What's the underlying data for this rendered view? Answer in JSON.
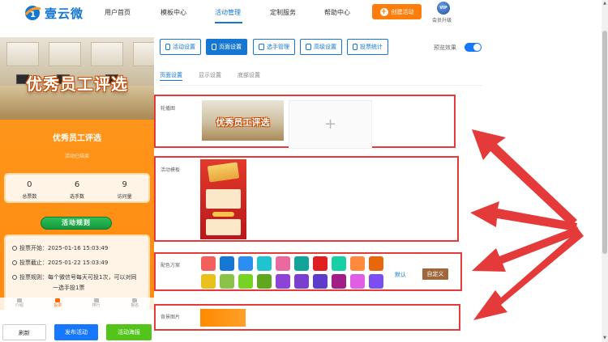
{
  "app": {
    "logo_text": "壹云微"
  },
  "nav": {
    "items": [
      "用户首页",
      "模板中心",
      "活动管理",
      "定制服务",
      "帮助中心"
    ],
    "active": "活动管理",
    "create_label": "创建活动",
    "vip_badge": "VIP",
    "vip_label": "会员升级"
  },
  "preview": {
    "banner_title": "优秀员工评选",
    "title": "优秀员工评选",
    "status": "活动已结束",
    "stats": [
      {
        "value": "0",
        "label": "总票数"
      },
      {
        "value": "6",
        "label": "选手数"
      },
      {
        "value": "9",
        "label": "访问量"
      }
    ],
    "rules_label": "活动规则",
    "info": {
      "start": "投票开始：2025-01-16 15:03:49",
      "end": "投票截止：2025-01-22 15:03:49",
      "rule_line1": "投票规则：每个微信号每天可投1次，可以对同",
      "rule_line2": "一选手投1票"
    },
    "bottom_tabs": [
      "介绍",
      "投票",
      "排行",
      "报名"
    ],
    "active_tab": "投票"
  },
  "actions": {
    "refresh": "刷新",
    "publish": "发布活动",
    "preview": "活动海报"
  },
  "toolbar": {
    "buttons": [
      "活动设置",
      "页面设置",
      "选手管理",
      "高级设置",
      "投票统计"
    ],
    "active": "页面设置",
    "preview_label": "预览效果",
    "preview_on": true
  },
  "subtabs": {
    "items": [
      "页面设置",
      "显示设置",
      "底部设置"
    ],
    "active": "页面设置"
  },
  "sections": {
    "carousel_label": "轮播图",
    "carousel_text": "优秀员工评选",
    "upload_plus": "+",
    "template_label": "活动模板",
    "color_label": "配色方案",
    "default_label": "默认",
    "custom_label": "自定义",
    "bg_label": "背景图片"
  },
  "palette": {
    "row1": [
      "#f25f5c",
      "#1478d4",
      "#2b8ef0",
      "#1fc4cf",
      "#ea6aa0",
      "#13a39b",
      "#e02020",
      "#18cfa6",
      "#ff8a3d",
      "#e8670b"
    ],
    "row2": [
      "#e8c11d",
      "#8bc34a",
      "#77d321",
      "#5fa71c",
      "#8d43d6",
      "#7b3fcf",
      "#5d3cc9",
      "#a31d86",
      "#e25de6",
      "#7c4df0"
    ]
  },
  "colors": {
    "accent": "#1677d2",
    "orange": "#ff7d0a",
    "highlight_border": "#e53a3a"
  }
}
